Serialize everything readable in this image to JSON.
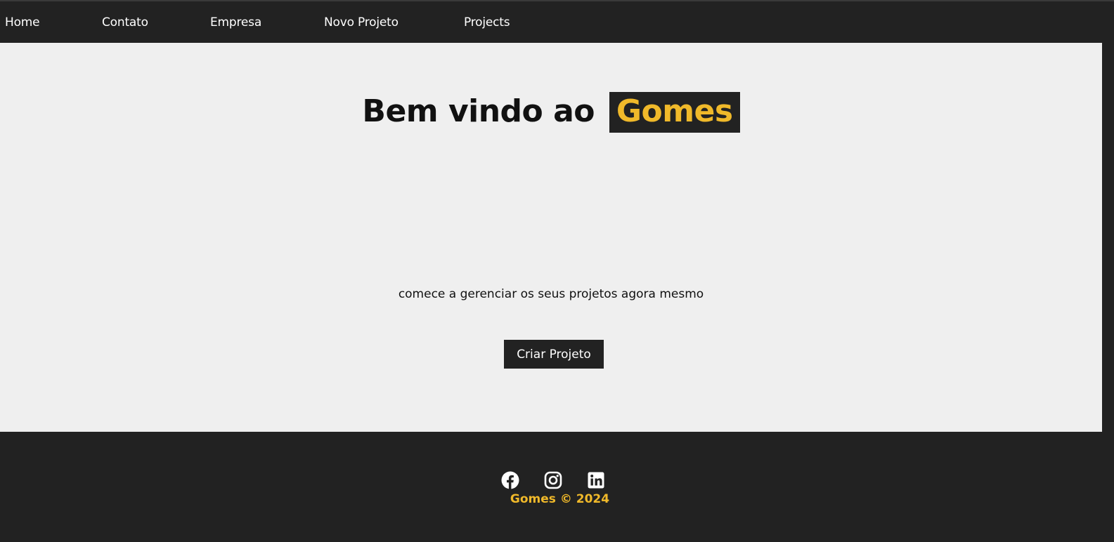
{
  "nav": {
    "items": [
      {
        "label": "Home"
      },
      {
        "label": "Contato"
      },
      {
        "label": "Empresa"
      },
      {
        "label": "Novo Projeto"
      },
      {
        "label": "Projects"
      }
    ]
  },
  "hero": {
    "title_prefix": "Bem vindo ao",
    "title_brand": "Gomes",
    "subtitle": "comece a gerenciar os seus projetos agora mesmo",
    "cta_label": "Criar Projeto"
  },
  "footer": {
    "social_icons": [
      "facebook-icon",
      "instagram-icon",
      "linkedin-icon"
    ],
    "brand": "Gomes",
    "copyright_symbol": "©",
    "year": "2024"
  },
  "colors": {
    "dark": "#222222",
    "accent": "#f0b92a",
    "background": "#efefef",
    "text": "#111111"
  }
}
